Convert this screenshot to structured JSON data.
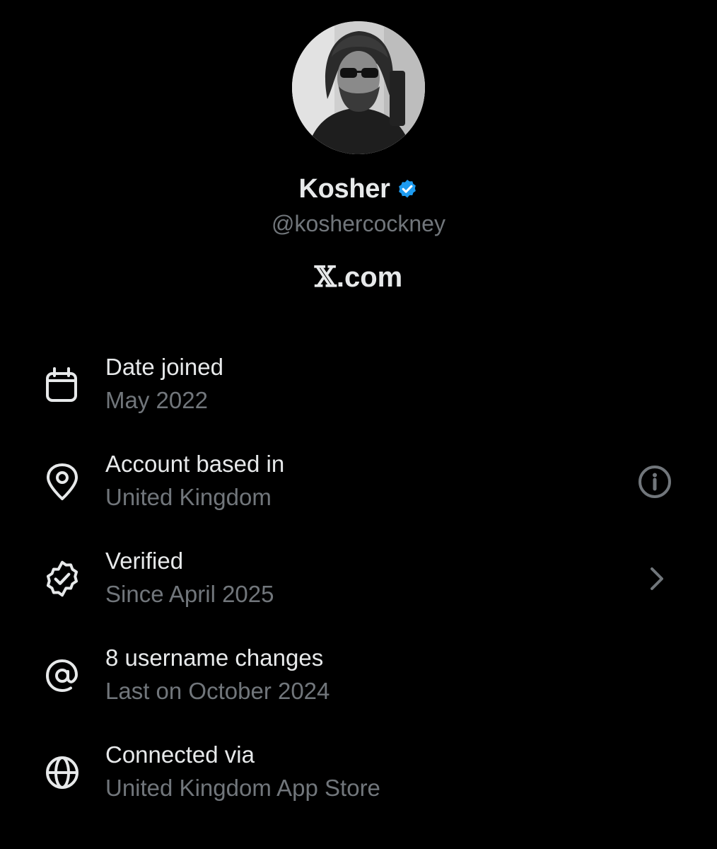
{
  "profile": {
    "display_name": "Kosher",
    "handle": "@koshercockney",
    "site": ".com",
    "site_glyph": "𝕏",
    "verified_color": "#1d9bf0"
  },
  "info": [
    {
      "icon": "calendar-icon",
      "title": "Date joined",
      "subtitle": "May 2022"
    },
    {
      "icon": "location-pin-icon",
      "title": "Account based in",
      "subtitle": "United Kingdom",
      "action_icon": "info-icon"
    },
    {
      "icon": "verified-badge-icon",
      "title": "Verified",
      "subtitle": "Since April 2025",
      "action_icon": "chevron-right-icon"
    },
    {
      "icon": "at-sign-icon",
      "title": "8 username changes",
      "subtitle": "Last on October 2024"
    },
    {
      "icon": "globe-icon",
      "title": "Connected via",
      "subtitle": "United Kingdom App Store"
    }
  ],
  "colors": {
    "background": "#000000",
    "primary_text": "#e7e9ea",
    "secondary_text": "#71767b"
  }
}
